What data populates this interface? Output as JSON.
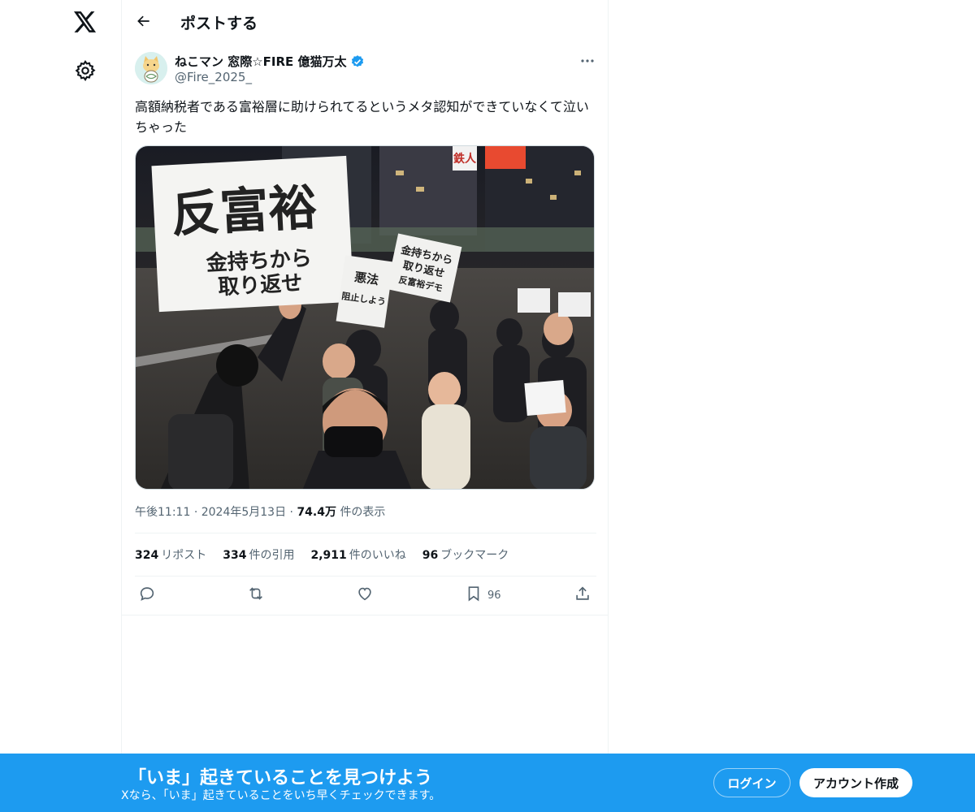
{
  "header": {
    "title": "ポストする"
  },
  "post": {
    "author": {
      "display_name": "ねこマン 窓際☆FIRE 億猫万太",
      "handle": "@Fire_2025_",
      "verified": true
    },
    "text": "高額納税者である富裕層に助けられてるというメタ認知ができていなくて泣いちゃった",
    "image": {
      "sign_main": "反富裕",
      "sign_line2": "金持ちから",
      "sign_line3": "取り返せ",
      "sign_right1": "金持ちから",
      "sign_right2": "取り返せ",
      "sign_right3": "反富裕デモ",
      "sign_left1": "悪法",
      "sign_left2": "阻止しよう",
      "store_sign": "鉄人"
    },
    "meta": {
      "time": "午後11:11",
      "date": "2024年5月13日",
      "views": "74.4万",
      "views_label": "件の表示"
    },
    "stats": {
      "reposts": "324",
      "reposts_label": "リポスト",
      "quotes": "334",
      "quotes_label": "件の引用",
      "likes": "2,911",
      "likes_label": "件のいいね",
      "bookmarks": "96",
      "bookmarks_label": "ブックマーク"
    },
    "actions": {
      "bookmark_count": "96"
    }
  },
  "banner": {
    "title": "「いま」起きていることを見つけよう",
    "subtitle": "Xなら、「いま」起きていることをいち早くチェックできます。",
    "login": "ログイン",
    "signup": "アカウント作成"
  },
  "colors": {
    "accent": "#1d9bf0",
    "text": "#0f1419",
    "muted": "#536471"
  },
  "icons": [
    "x-logo-icon",
    "gear-icon",
    "back-arrow-icon",
    "verified-badge-icon",
    "more-icon",
    "reply-icon",
    "repost-icon",
    "like-icon",
    "bookmark-icon",
    "share-icon"
  ]
}
